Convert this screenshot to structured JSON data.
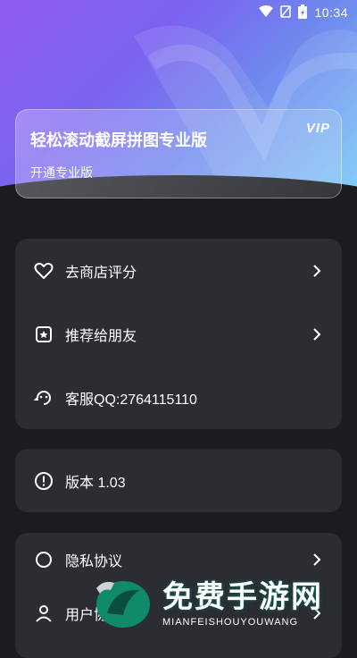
{
  "status_bar": {
    "time": "10:34"
  },
  "vip_card": {
    "title": "轻松滚动截屏拼图专业版",
    "subtitle": "开通专业版",
    "badge": "VIP"
  },
  "menu_group_1": [
    {
      "label": "去商店评分",
      "icon": "heart-icon"
    },
    {
      "label": "推荐给朋友",
      "icon": "share-card-icon"
    },
    {
      "label": "客服QQ:2764115110",
      "icon": "customer-service-icon"
    }
  ],
  "menu_group_2": [
    {
      "label": "版本 1.03",
      "icon": "info-icon"
    }
  ],
  "menu_group_3": [
    {
      "label": "隐私协议",
      "icon": "privacy-icon"
    },
    {
      "label": "用户协议",
      "icon": "user-icon"
    }
  ],
  "watermark": {
    "title": "免费手游网",
    "subtitle": "MIANFEISHOUYOUWANG"
  }
}
